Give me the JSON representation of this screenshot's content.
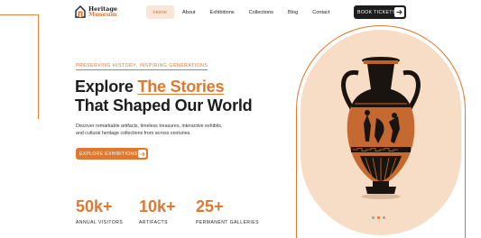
{
  "brand": {
    "line1": "Heritage",
    "line2": "Museum",
    "icon": "museum-logo-icon"
  },
  "nav": {
    "items": [
      "Home",
      "About",
      "Exhibitions",
      "Collections",
      "Blog",
      "Contact"
    ],
    "active": "Home"
  },
  "header": {
    "book_label": "BOOK TICKETS",
    "book_icon": "arrow-right-icon"
  },
  "hero": {
    "eyebrow": "PRESERVING HISTORY, INSPIRING GENERATIONS",
    "title_pre": "Explore ",
    "title_accent": "The Stories",
    "title_line2": "That Shaped Our World",
    "description": "Discover remarkable artifacts, timeless treasures, interactive exhibits, and cultural heritage collections from across centuries.",
    "cta_label": "EXPLORE EXHIBITIONS",
    "cta_icon": "arrow-right-icon"
  },
  "stats": [
    {
      "value": "50k+",
      "label": "ANNUAL VISITORS"
    },
    {
      "value": "10k+",
      "label": "ARTIFACTS"
    },
    {
      "value": "25+",
      "label": "PERMANENT GALLERIES"
    }
  ],
  "carousel": {
    "image": "greek-amphora-vase",
    "slides": 3,
    "active_slide": 2
  },
  "colors": {
    "accent": "#e0782f",
    "dark": "#1d1d1d",
    "card_bg": "#f8ddc6",
    "nav_active_bg": "#f7e6d9"
  }
}
